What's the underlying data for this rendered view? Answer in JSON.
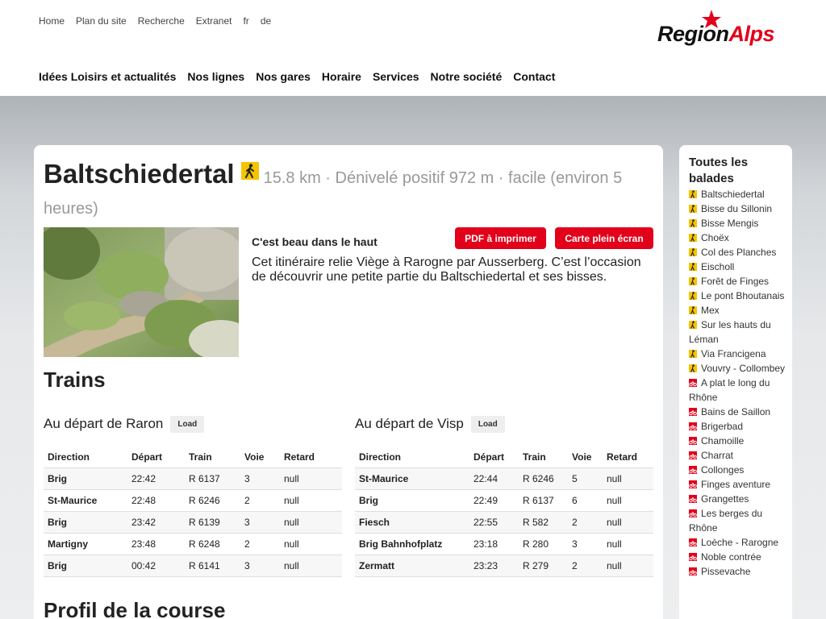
{
  "util_nav": [
    "Home",
    "Plan du site",
    "Recherche",
    "Extranet",
    "fr",
    "de"
  ],
  "logo": {
    "part1": "Region",
    "part2": "Alps"
  },
  "main_nav": [
    "Idées Loisirs et actualités",
    "Nos lignes",
    "Nos gares",
    "Horaire",
    "Services",
    "Notre société",
    "Contact"
  ],
  "hike": {
    "title": "Baltschiedertal",
    "meta": "15.8 km · Dénivelé positif 972 m · facile (environ 5 heures)",
    "subtitle": "C'est beau dans le haut",
    "pdf_button": "PDF à imprimer",
    "fullscreen_button": "Carte plein écran",
    "description": "Cet itinéraire relie Viège à Rarogne par Ausserberg. C’est l’occasion de découvrir une petite partie du Baltschiedertal et ses bisses."
  },
  "trains": {
    "heading": "Trains",
    "columns": [
      "Direction",
      "Départ",
      "Train",
      "Voie",
      "Retard"
    ],
    "load_label": "Load",
    "raron": {
      "title": "Au départ de Raron",
      "rows": [
        [
          "Brig",
          "22:42",
          "R 6137",
          "3",
          "null"
        ],
        [
          "St-Maurice",
          "22:48",
          "R 6246",
          "2",
          "null"
        ],
        [
          "Brig",
          "23:42",
          "R 6139",
          "3",
          "null"
        ],
        [
          "Martigny",
          "23:48",
          "R 6248",
          "2",
          "null"
        ],
        [
          "Brig",
          "00:42",
          "R 6141",
          "3",
          "null"
        ]
      ]
    },
    "visp": {
      "title": "Au départ de Visp",
      "rows": [
        [
          "St-Maurice",
          "22:44",
          "R 6246",
          "5",
          "null"
        ],
        [
          "Brig",
          "22:49",
          "R 6137",
          "6",
          "null"
        ],
        [
          "Fiesch",
          "22:55",
          "R 582",
          "2",
          "null"
        ],
        [
          "Brig Bahnhofplatz",
          "23:18",
          "R 280",
          "3",
          "null"
        ],
        [
          "Zermatt",
          "23:23",
          "R 279",
          "2",
          "null"
        ]
      ]
    }
  },
  "profil_heading": "Profil de la course",
  "sidebar": {
    "title": "Toutes les balades",
    "items": [
      {
        "label": "Baltschiedertal",
        "type": "walk"
      },
      {
        "label": "Bisse du Sillonin",
        "type": "walk"
      },
      {
        "label": "Bisse Mengis",
        "type": "walk"
      },
      {
        "label": "Choëx",
        "type": "walk"
      },
      {
        "label": "Col des Planches",
        "type": "walk"
      },
      {
        "label": "Eischoll",
        "type": "walk"
      },
      {
        "label": "Forêt de Finges",
        "type": "walk"
      },
      {
        "label": "Le pont Bhoutanais",
        "type": "walk"
      },
      {
        "label": "Mex",
        "type": "walk"
      },
      {
        "label": "Sur les hauts du Léman",
        "type": "walk"
      },
      {
        "label": "Via Francigena",
        "type": "walk"
      },
      {
        "label": "Vouvry - Collombey",
        "type": "walk"
      },
      {
        "label": "A plat le long du Rhône",
        "type": "bike"
      },
      {
        "label": "Bains de Saillon",
        "type": "bike"
      },
      {
        "label": "Brigerbad",
        "type": "bike"
      },
      {
        "label": "Chamoille",
        "type": "bike"
      },
      {
        "label": "Charrat",
        "type": "bike"
      },
      {
        "label": "Collonges",
        "type": "bike"
      },
      {
        "label": "Finges aventure",
        "type": "bike"
      },
      {
        "label": "Grangettes",
        "type": "bike"
      },
      {
        "label": "Les berges du Rhône",
        "type": "bike"
      },
      {
        "label": "Loèche - Rarogne",
        "type": "bike"
      },
      {
        "label": "Noble contrée",
        "type": "bike"
      },
      {
        "label": "Pissevache",
        "type": "bike"
      }
    ]
  },
  "colors": {
    "accent": "#e2001a",
    "walk_icon": "#f5c400"
  }
}
